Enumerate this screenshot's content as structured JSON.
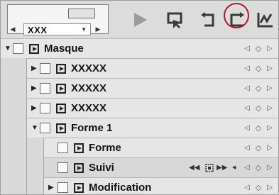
{
  "toolbar": {
    "timeline_combo": {
      "value": "XXX"
    },
    "buttons": [
      {
        "name": "play-button",
        "icon": "play-icon"
      },
      {
        "name": "preview-button",
        "icon": "preview-icon"
      },
      {
        "name": "undo-button",
        "icon": "undo-icon"
      },
      {
        "name": "redo-button",
        "icon": "redo-icon"
      },
      {
        "name": "graph-button",
        "icon": "graph-icon"
      }
    ]
  },
  "tree": {
    "items": [
      {
        "label": "Masque",
        "expanded": true,
        "keyframe_nav": true
      },
      {
        "label": "XXXXX",
        "expanded": false,
        "keyframe_nav": true
      },
      {
        "label": "XXXXX",
        "expanded": false,
        "keyframe_nav": true
      },
      {
        "label": "XXXXX",
        "expanded": false,
        "keyframe_nav": true
      },
      {
        "label": "Forme 1",
        "expanded": true,
        "keyframe_nav": true
      },
      {
        "label": "Forme",
        "keyframe_nav": true
      },
      {
        "label": "Suivi",
        "keyframe_nav": true,
        "tracking_controls": [
          "track-backward",
          "track-reverse",
          "track-frame",
          "track-forward",
          "track-step"
        ]
      },
      {
        "label": "Modification",
        "expanded": false,
        "keyframe_nav": true
      }
    ]
  },
  "colors": {
    "highlight_circle": "#b3152a",
    "toolbar_icon": "#3a3a3a"
  }
}
